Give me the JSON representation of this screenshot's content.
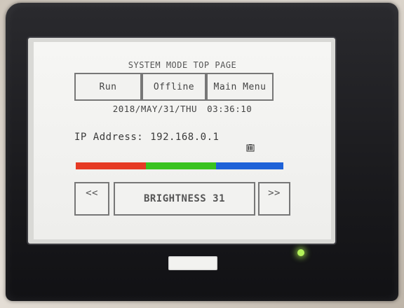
{
  "screen": {
    "title": "SYSTEM MODE TOP PAGE",
    "buttons": {
      "run": "Run",
      "offline": "Offline",
      "main_menu": "Main Menu"
    },
    "date": "2018/MAY/31/THU",
    "time": "03:36:10",
    "ip_label": "IP Address:",
    "ip_value": "192.168.0.1",
    "nav_prev": "<<",
    "brightness_label": "BRIGHTNESS 31",
    "nav_next": ">>"
  },
  "color_bar": [
    "#e63a24",
    "#39c31f",
    "#1e62d8"
  ],
  "icons": {
    "battery": "battery-icon"
  }
}
